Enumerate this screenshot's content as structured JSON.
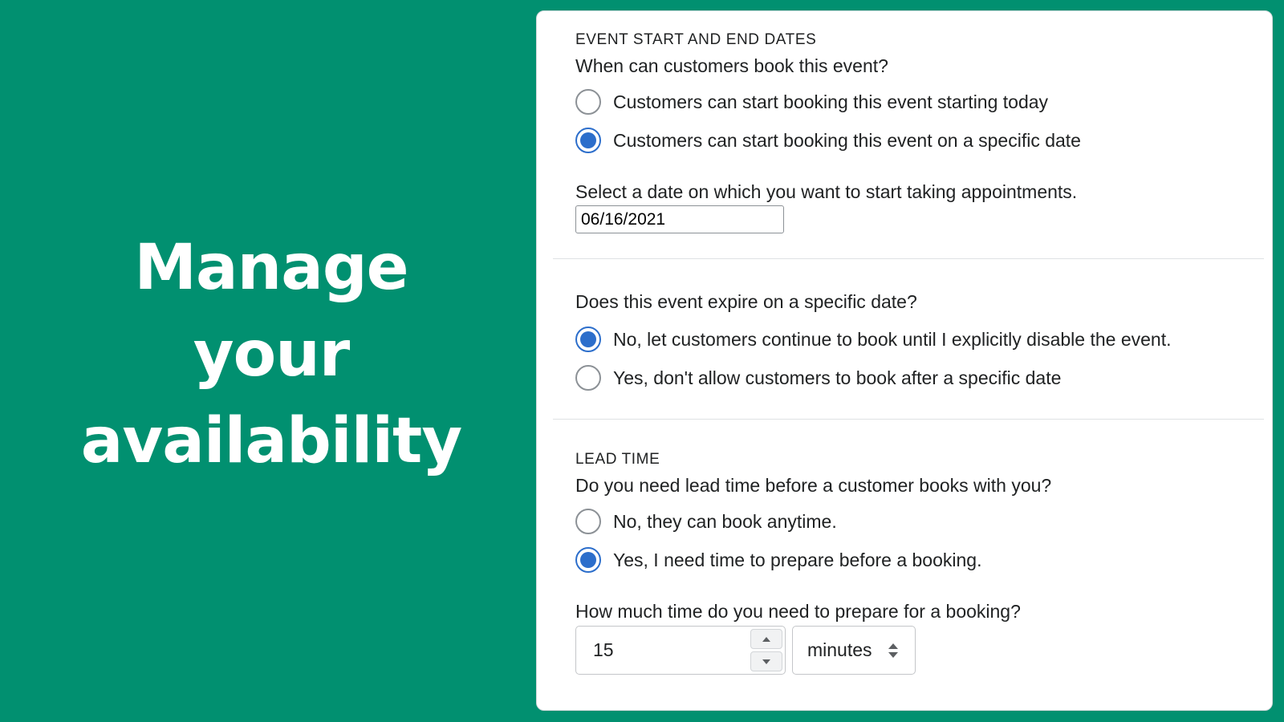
{
  "hero": {
    "lines": [
      "Manage",
      "your",
      "availability"
    ]
  },
  "start_section": {
    "heading": "EVENT START AND END DATES",
    "question": "When can customers book this event?",
    "options": [
      {
        "label": "Customers can start booking this event starting today",
        "checked": false
      },
      {
        "label": "Customers can start booking this event on a specific date",
        "checked": true
      }
    ],
    "date_prompt": "Select a date on which you want to start taking appointments.",
    "date_value": "06/16/2021"
  },
  "expire_section": {
    "question": "Does this event expire on a specific date?",
    "options": [
      {
        "label": "No, let customers continue to book until I explicitly disable the event.",
        "checked": true
      },
      {
        "label": "Yes, don't allow customers to book after a specific date",
        "checked": false
      }
    ]
  },
  "lead_section": {
    "heading": "LEAD TIME",
    "question": "Do you need lead time before a customer books with you?",
    "options": [
      {
        "label": "No, they can book anytime.",
        "checked": false
      },
      {
        "label": "Yes, I need time to prepare before a booking.",
        "checked": true
      }
    ],
    "prep_prompt": "How much time do you need to prepare for a booking?",
    "prep_value": "15",
    "prep_unit": "minutes"
  },
  "colors": {
    "background": "#019070",
    "accent": "#2c6ecb",
    "text": "#202223"
  }
}
